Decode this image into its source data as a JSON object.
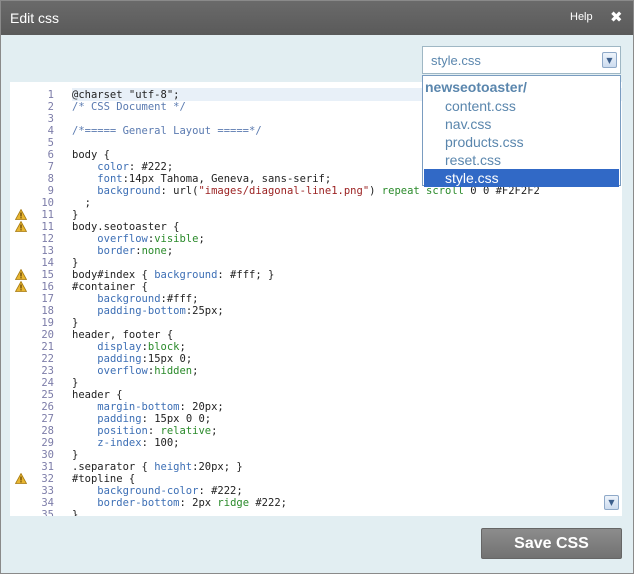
{
  "window": {
    "title": "Edit css",
    "help_label": "Help",
    "close_glyph": "✖"
  },
  "file_select": {
    "selected": "style.css",
    "group": "newseotoaster/",
    "options": [
      "content.css",
      "nav.css",
      "products.css",
      "reset.css",
      "style.css"
    ],
    "highlighted": "style.css"
  },
  "editor": {
    "lines": [
      {
        "n": "1",
        "warn": false,
        "tokens": [
          [
            "plain",
            "@charset \"utf-8\";"
          ]
        ]
      },
      {
        "n": "2",
        "warn": false,
        "tokens": [
          [
            "comment",
            "/* CSS Document */"
          ]
        ]
      },
      {
        "n": "3",
        "warn": false,
        "tokens": []
      },
      {
        "n": "4",
        "warn": false,
        "tokens": [
          [
            "comment",
            "/*===== General Layout =====*/"
          ]
        ]
      },
      {
        "n": "5",
        "warn": false,
        "tokens": []
      },
      {
        "n": "6",
        "warn": false,
        "tokens": [
          [
            "plain",
            "body {"
          ]
        ]
      },
      {
        "n": "7",
        "warn": false,
        "tokens": [
          [
            "plain",
            "    "
          ],
          [
            "prop",
            "color"
          ],
          [
            "plain",
            ": #222;"
          ]
        ]
      },
      {
        "n": "8",
        "warn": false,
        "tokens": [
          [
            "plain",
            "    "
          ],
          [
            "prop",
            "font"
          ],
          [
            "plain",
            ":14px Tahoma, Geneva, sans-serif;"
          ]
        ]
      },
      {
        "n": "9",
        "warn": false,
        "tokens": [
          [
            "plain",
            "    "
          ],
          [
            "prop",
            "background"
          ],
          [
            "plain",
            ": url("
          ],
          [
            "str",
            "\"images/diagonal-line1.png\""
          ],
          [
            "plain",
            ") "
          ],
          [
            "green",
            "repeat scroll"
          ],
          [
            "plain",
            " 0 0 #F2F2F2"
          ]
        ]
      },
      {
        "n": "10",
        "warn": false,
        "tokens": [
          [
            "plain",
            "  ;"
          ]
        ]
      },
      {
        "n": "11",
        "warn": true,
        "tokens": [
          [
            "plain",
            "}"
          ]
        ]
      },
      {
        "n": "11",
        "warn": true,
        "tokens": [
          [
            "plain",
            "body.seotoaster {"
          ]
        ]
      },
      {
        "n": "12",
        "warn": false,
        "tokens": [
          [
            "plain",
            "    "
          ],
          [
            "prop",
            "overflow"
          ],
          [
            "plain",
            ":"
          ],
          [
            "green",
            "visible"
          ],
          [
            "plain",
            ";"
          ]
        ]
      },
      {
        "n": "13",
        "warn": false,
        "tokens": [
          [
            "plain",
            "    "
          ],
          [
            "prop",
            "border"
          ],
          [
            "plain",
            ":"
          ],
          [
            "green",
            "none"
          ],
          [
            "plain",
            ";"
          ]
        ]
      },
      {
        "n": "14",
        "warn": false,
        "tokens": [
          [
            "plain",
            "}"
          ]
        ]
      },
      {
        "n": "15",
        "warn": true,
        "tokens": [
          [
            "plain",
            "body#index { "
          ],
          [
            "prop",
            "background"
          ],
          [
            "plain",
            ": #fff; }"
          ]
        ]
      },
      {
        "n": "16",
        "warn": true,
        "tokens": [
          [
            "plain",
            "#container {"
          ]
        ]
      },
      {
        "n": "17",
        "warn": false,
        "tokens": [
          [
            "plain",
            "    "
          ],
          [
            "prop",
            "background"
          ],
          [
            "plain",
            ":#fff;"
          ]
        ]
      },
      {
        "n": "18",
        "warn": false,
        "tokens": [
          [
            "plain",
            "    "
          ],
          [
            "prop",
            "padding-bottom"
          ],
          [
            "plain",
            ":25px;"
          ]
        ]
      },
      {
        "n": "19",
        "warn": false,
        "tokens": [
          [
            "plain",
            "}"
          ]
        ]
      },
      {
        "n": "20",
        "warn": false,
        "tokens": [
          [
            "plain",
            "header, footer {"
          ]
        ]
      },
      {
        "n": "21",
        "warn": false,
        "tokens": [
          [
            "plain",
            "    "
          ],
          [
            "prop",
            "display"
          ],
          [
            "plain",
            ":"
          ],
          [
            "green",
            "block"
          ],
          [
            "plain",
            ";"
          ]
        ]
      },
      {
        "n": "22",
        "warn": false,
        "tokens": [
          [
            "plain",
            "    "
          ],
          [
            "prop",
            "padding"
          ],
          [
            "plain",
            ":15px 0;"
          ]
        ]
      },
      {
        "n": "23",
        "warn": false,
        "tokens": [
          [
            "plain",
            "    "
          ],
          [
            "prop",
            "overflow"
          ],
          [
            "plain",
            ":"
          ],
          [
            "green",
            "hidden"
          ],
          [
            "plain",
            ";"
          ]
        ]
      },
      {
        "n": "24",
        "warn": false,
        "tokens": [
          [
            "plain",
            "}"
          ]
        ]
      },
      {
        "n": "25",
        "warn": false,
        "tokens": [
          [
            "plain",
            "header {"
          ]
        ]
      },
      {
        "n": "26",
        "warn": false,
        "tokens": [
          [
            "plain",
            "    "
          ],
          [
            "prop",
            "margin-bottom"
          ],
          [
            "plain",
            ": 20px;"
          ]
        ]
      },
      {
        "n": "27",
        "warn": false,
        "tokens": [
          [
            "plain",
            "    "
          ],
          [
            "prop",
            "padding"
          ],
          [
            "plain",
            ": 15px 0 0;"
          ]
        ]
      },
      {
        "n": "28",
        "warn": false,
        "tokens": [
          [
            "plain",
            "    "
          ],
          [
            "prop",
            "position"
          ],
          [
            "plain",
            ": "
          ],
          [
            "green",
            "relative"
          ],
          [
            "plain",
            ";"
          ]
        ]
      },
      {
        "n": "29",
        "warn": false,
        "tokens": [
          [
            "plain",
            "    "
          ],
          [
            "prop",
            "z-index"
          ],
          [
            "plain",
            ": 100;"
          ]
        ]
      },
      {
        "n": "30",
        "warn": false,
        "tokens": [
          [
            "plain",
            "}"
          ]
        ]
      },
      {
        "n": "31",
        "warn": false,
        "tokens": [
          [
            "plain",
            ".separator { "
          ],
          [
            "prop",
            "height"
          ],
          [
            "plain",
            ":20px; }"
          ]
        ]
      },
      {
        "n": "32",
        "warn": true,
        "tokens": [
          [
            "plain",
            "#topline {"
          ]
        ]
      },
      {
        "n": "33",
        "warn": false,
        "tokens": [
          [
            "plain",
            "    "
          ],
          [
            "prop",
            "background-color"
          ],
          [
            "plain",
            ": #222;"
          ]
        ]
      },
      {
        "n": "34",
        "warn": false,
        "tokens": [
          [
            "plain",
            "    "
          ],
          [
            "prop",
            "border-bottom"
          ],
          [
            "plain",
            ": 2px "
          ],
          [
            "green",
            "ridge"
          ],
          [
            "plain",
            " #222;"
          ]
        ]
      },
      {
        "n": "35",
        "warn": false,
        "tokens": [
          [
            "plain",
            "}"
          ]
        ]
      }
    ]
  },
  "footer": {
    "save_label": "Save CSS"
  },
  "icons": {
    "warning": "warning-icon",
    "close": "close-icon",
    "dropdown": "chevron-down-icon"
  },
  "colors": {
    "highlight": "#3169c6",
    "titlebar": "#5e5e5e",
    "dialog_bg": "#e2eef2"
  }
}
